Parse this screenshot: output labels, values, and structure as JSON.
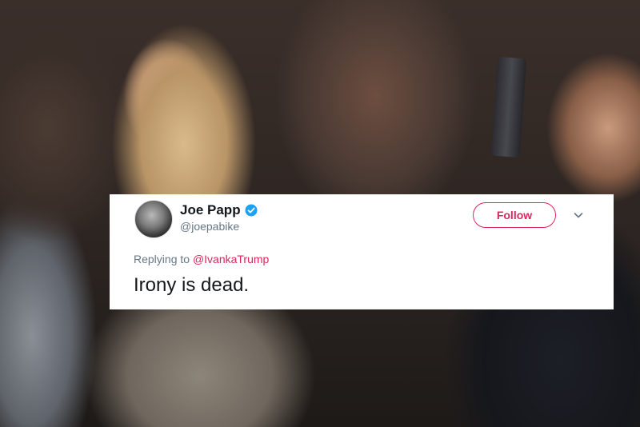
{
  "tweet": {
    "display_name": "Joe Papp",
    "handle": "@joepabike",
    "follow_label": "Follow",
    "replying_to_prefix": "Replying to",
    "replying_to_handle": "@IvankaTrump",
    "text": "Irony is dead."
  },
  "icons": {
    "verified": "verified-badge-icon",
    "more": "chevron-down-icon"
  },
  "colors": {
    "accent": "#e0245e",
    "verified": "#1da1f2",
    "secondary_text": "#657786",
    "primary_text": "#14171a"
  }
}
